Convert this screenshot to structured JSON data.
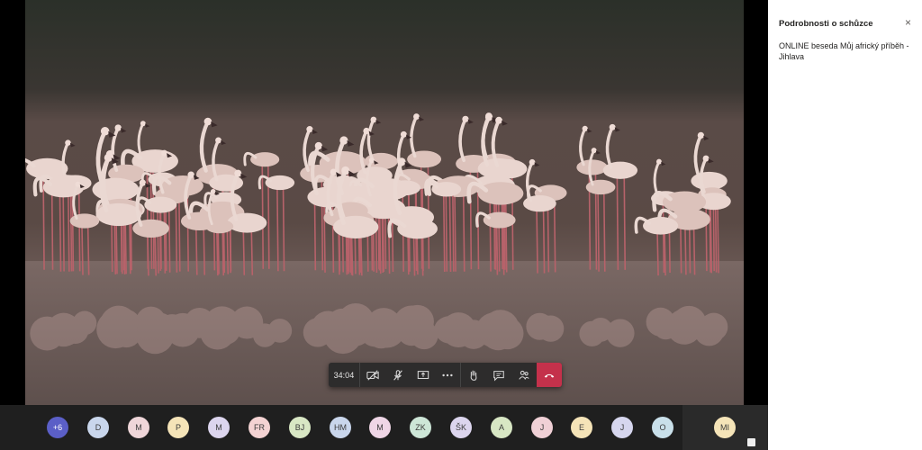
{
  "panel": {
    "title": "Podrobnosti o schůzce",
    "close_glyph": "×",
    "meeting_name": "ONLINE beseda Můj africký příběh - Jihlava"
  },
  "toolbar": {
    "timer": "34:04",
    "buttons": [
      {
        "icon": "camera-off-icon"
      },
      {
        "icon": "mic-off-icon"
      },
      {
        "icon": "share-screen-icon"
      },
      {
        "icon": "more-options-icon"
      },
      {
        "icon": "raise-hand-icon"
      },
      {
        "icon": "chat-icon"
      },
      {
        "icon": "participants-icon"
      },
      {
        "icon": "hang-up-icon"
      }
    ],
    "hangup_color": "#c4314b"
  },
  "participants": [
    {
      "initials": "+6",
      "color": "#5b5fc7",
      "text_color": "#ffffff"
    },
    {
      "initials": "D",
      "color": "#c9d6ec"
    },
    {
      "initials": "M",
      "color": "#efd6d9"
    },
    {
      "initials": "P",
      "color": "#f5e4b8"
    },
    {
      "initials": "M",
      "color": "#dcd5ee"
    },
    {
      "initials": "FR",
      "color": "#f4d3d3"
    },
    {
      "initials": "BJ",
      "color": "#d8e7c4"
    },
    {
      "initials": "HM",
      "color": "#c9d6ec"
    },
    {
      "initials": "M",
      "color": "#efd6e6"
    },
    {
      "initials": "ZK",
      "color": "#cde6d7"
    },
    {
      "initials": "ŠK",
      "color": "#dcd5ee"
    },
    {
      "initials": "A",
      "color": "#d8e7c4"
    },
    {
      "initials": "J",
      "color": "#f0d0d6"
    },
    {
      "initials": "E",
      "color": "#f5e4b8"
    },
    {
      "initials": "J",
      "color": "#d6d6ee"
    },
    {
      "initials": "O",
      "color": "#c9e0ea"
    }
  ],
  "self": {
    "initials": "MI",
    "color": "#f5e4b8"
  }
}
